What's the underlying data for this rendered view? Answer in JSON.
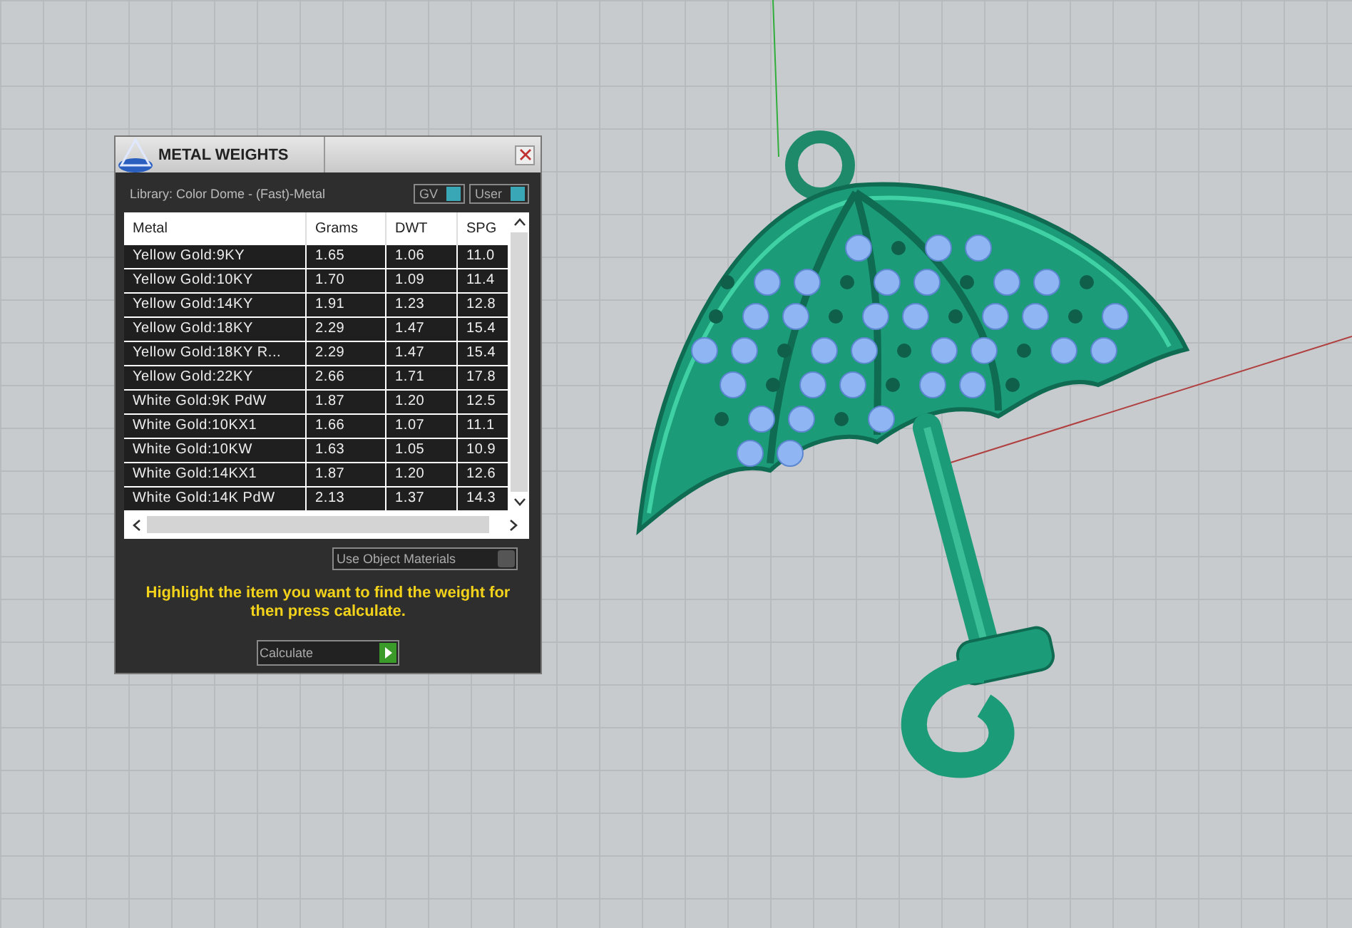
{
  "dialog": {
    "title": "METAL WEIGHTS",
    "library": "Library: Color Dome - (Fast)-Metal",
    "toggles": [
      {
        "label": "GV",
        "on": true
      },
      {
        "label": "User",
        "on": true
      }
    ],
    "table": {
      "columns": [
        "Metal",
        "Grams",
        "DWT",
        "SPG"
      ],
      "rows": [
        [
          "Yellow Gold:9KY",
          "1.65",
          "1.06",
          "11.0"
        ],
        [
          "Yellow Gold:10KY",
          "1.70",
          "1.09",
          "11.4"
        ],
        [
          "Yellow Gold:14KY",
          "1.91",
          "1.23",
          "12.8"
        ],
        [
          "Yellow Gold:18KY",
          "2.29",
          "1.47",
          "15.4"
        ],
        [
          "Yellow Gold:18KY R...",
          "2.29",
          "1.47",
          "15.4"
        ],
        [
          "Yellow Gold:22KY",
          "2.66",
          "1.71",
          "17.8"
        ],
        [
          "White Gold:9K PdW",
          "1.87",
          "1.20",
          "12.5"
        ],
        [
          "White Gold:10KX1",
          "1.66",
          "1.07",
          "11.1"
        ],
        [
          "White Gold:10KW",
          "1.63",
          "1.05",
          "10.9"
        ],
        [
          "White Gold:14KX1",
          "1.87",
          "1.20",
          "12.6"
        ],
        [
          "White Gold:14K PdW",
          "2.13",
          "1.37",
          "14.3"
        ]
      ]
    },
    "use_object_materials": {
      "label": "Use Object Materials",
      "on": false
    },
    "instruction": "Highlight the item you want to find the weight for then press calculate.",
    "calculate_button": "Calculate"
  }
}
